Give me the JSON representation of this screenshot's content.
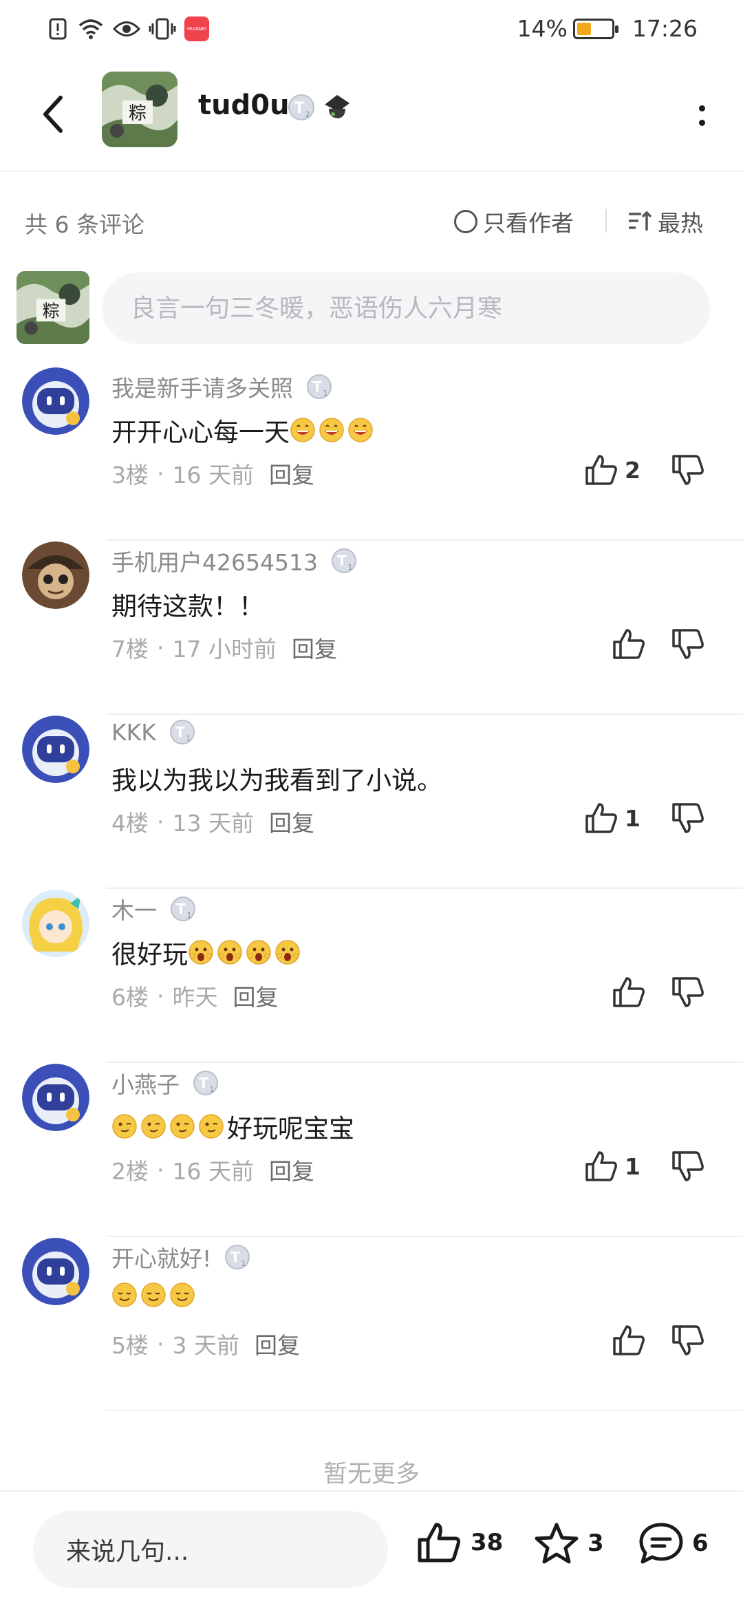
{
  "status_bar": {
    "battery": "14%",
    "time": "17:26",
    "app_badge": "HUAWEI"
  },
  "header": {
    "username": "tud0u",
    "level_badge": "T",
    "level_num": "2"
  },
  "toolbar": {
    "count_label": "共 6 条评论",
    "author_only": "只看作者",
    "sort_label": "最热"
  },
  "composer": {
    "placeholder": "良言一句三冬暖，恶语伤人六月寒"
  },
  "comments": [
    {
      "user": "我是新手请多关照",
      "badge_num": "1",
      "text": "开开心心每一天",
      "emoji": [
        "grin",
        "grin",
        "grin"
      ],
      "emoji_pos": "after",
      "floor": "3楼",
      "time": "16 天前",
      "reply": "回复",
      "likes": "2",
      "avatar": "robot"
    },
    {
      "user": "手机用户42654513",
      "badge_num": "1",
      "text": "期待这款！！",
      "emoji": [],
      "emoji_pos": "after",
      "floor": "7楼",
      "time": "17 小时前",
      "reply": "回复",
      "likes": "",
      "avatar": "pirate"
    },
    {
      "user": "KKK",
      "badge_num": "1",
      "text": "我以为我以为我看到了小说。",
      "emoji": [],
      "emoji_pos": "after",
      "floor": "4楼",
      "time": "13 天前",
      "reply": "回复",
      "likes": "1",
      "avatar": "robot"
    },
    {
      "user": "木一",
      "badge_num": "1",
      "text": "很好玩",
      "emoji": [
        "scream",
        "scream",
        "scream",
        "scream"
      ],
      "emoji_pos": "after",
      "floor": "6楼",
      "time": "昨天",
      "reply": "回复",
      "likes": "",
      "avatar": "girl"
    },
    {
      "user": "小燕子",
      "badge_num": "1",
      "text": "好玩呢宝宝",
      "emoji": [
        "wink",
        "wink",
        "wink",
        "wink"
      ],
      "emoji_pos": "before",
      "floor": "2楼",
      "time": "16 天前",
      "reply": "回复",
      "likes": "1",
      "avatar": "robot"
    },
    {
      "user": "开心就好!",
      "badge_num": "1",
      "text": "",
      "emoji": [
        "relieved",
        "relieved",
        "relieved"
      ],
      "emoji_pos": "after",
      "floor": "5楼",
      "time": "3 天前",
      "reply": "回复",
      "likes": "",
      "avatar": "robot"
    }
  ],
  "no_more": "暂无更多",
  "bottom_bar": {
    "input_label": "来说几句...",
    "likes": "38",
    "favorites": "3",
    "comments": "6"
  }
}
